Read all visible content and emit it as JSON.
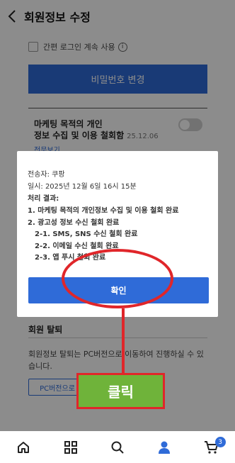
{
  "header": {
    "title": "회원정보 수정",
    "back_icon": "chevron-left-icon"
  },
  "login": {
    "keep_label": "간편 로그인 계속 사용",
    "info_icon_text": "i"
  },
  "password": {
    "change_label": "비밀번호 변경"
  },
  "marketing": {
    "title_line1": "마케팅 목적의 개인",
    "title_line2": "정보 수집 및 이용 철회함",
    "date": "25.12.06",
    "full_text_link": "전문보기",
    "toggle_on": false
  },
  "modal": {
    "sender": "전송자: 쿠팡",
    "datetime": "일시: 2025년 12월 6일 16시 15분",
    "result_heading": "처리 결과:",
    "items": [
      "1. 마케팅 목적의 개인정보 수집 및 이용 철회 완료",
      "2. 광고성 정보 수신 철회 완료",
      "2-1. SMS, SNS 수신 철회 완료",
      "2-2. 이메일 수신 철회 완료",
      "2-3. 앱 푸시 철회 완료"
    ],
    "confirm_label": "확인"
  },
  "withdraw": {
    "title": "회원 탈퇴",
    "desc": "회원정보 탈퇴는 PC버전으로 이동하여 진행하실 수 있습니다.",
    "pc_button": "PC버전으로"
  },
  "annotation": {
    "label": "클릭",
    "color": "#e0262a",
    "label_bg": "#6fb33a"
  },
  "bottom_nav": {
    "items": [
      "home-icon",
      "grid-icon",
      "search-icon",
      "person-icon",
      "cart-icon"
    ],
    "cart_count": "3",
    "active_index": 3
  },
  "colors": {
    "accent": "#2f6bd8"
  }
}
